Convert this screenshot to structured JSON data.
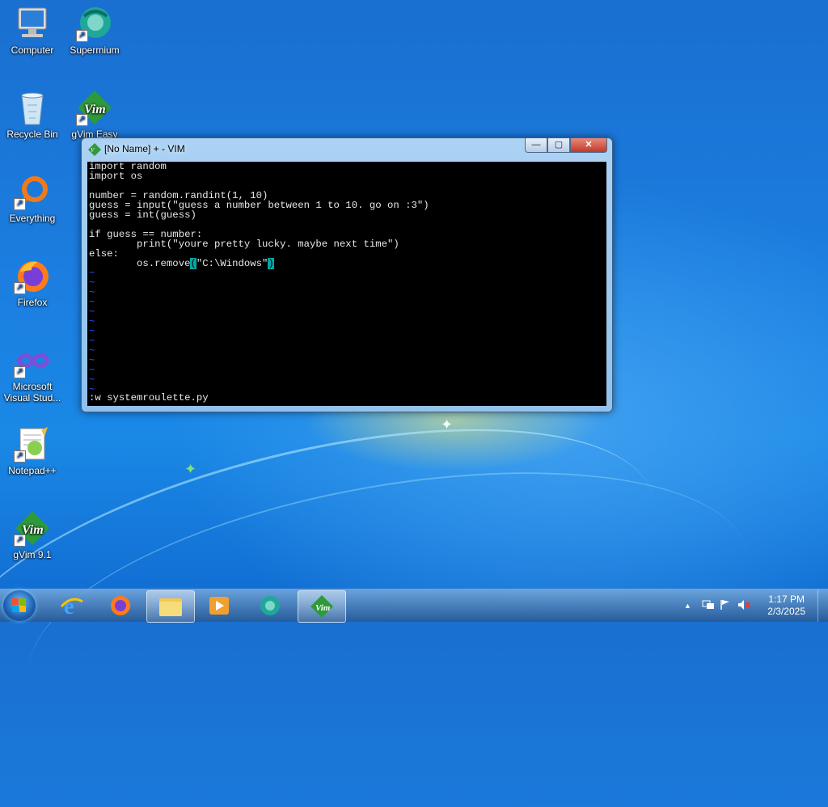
{
  "desktop": {
    "icons": [
      {
        "label": "Computer"
      },
      {
        "label": "Supermium"
      },
      {
        "label": "Recycle Bin"
      },
      {
        "label": "gVim Easy 9.1"
      },
      {
        "label": "Everything"
      },
      {
        "label": "Firefox"
      },
      {
        "label": "Microsoft Visual Stud..."
      },
      {
        "label": "Notepad++"
      },
      {
        "label": "gVim 9.1"
      }
    ]
  },
  "vim": {
    "title": "[No Name] + - VIM",
    "buttons": {
      "minimize": "—",
      "maximize": "▢",
      "close": "✕"
    },
    "lines": [
      "import random",
      "import os",
      "",
      "number = random.randint(1, 10)",
      "guess = input(\"guess a number between 1 to 10. go on :3\")",
      "guess = int(guess)",
      "",
      "if guess == number:",
      "        print(\"youre pretty lucky. maybe next time\")",
      "else:"
    ],
    "last_line": {
      "prefix": "        os.remove",
      "open_paren": "(",
      "arg": "\"C:\\Windows\"",
      "close_paren": ")"
    },
    "tilde": "~",
    "command_line": ":w systemroulette.py"
  },
  "taskbar": {
    "clock_time": "1:17 PM",
    "clock_date": "2/3/2025",
    "tray_arrow": "▲"
  },
  "colors": {
    "vim_background": "#000000",
    "vim_tilde": "#3050ff",
    "vim_match_highlight": "#00a8a8",
    "close_button": "#c0392b"
  }
}
